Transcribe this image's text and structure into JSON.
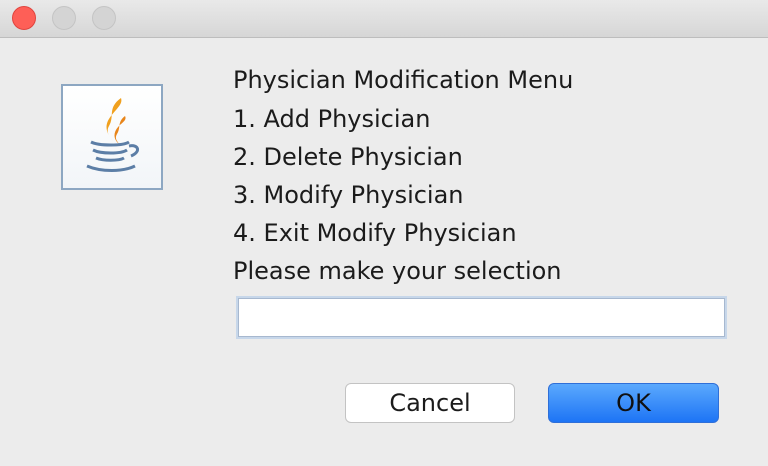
{
  "titlebar": {
    "controls": [
      "close",
      "minimize",
      "zoom"
    ]
  },
  "icon": {
    "name": "java-coffee-cup-icon"
  },
  "menu": {
    "title": "Physician Modification Menu",
    "option1": "1. Add Physician",
    "option2": "2. Delete Physician",
    "option3": "3. Modify Physician",
    "option4": "4. Exit Modify Physician",
    "prompt": "Please make your selection"
  },
  "input": {
    "value": "",
    "placeholder": ""
  },
  "buttons": {
    "cancel_label": "Cancel",
    "ok_label": "OK"
  },
  "colors": {
    "close_button": "#fe5f57",
    "ok_button": "#1d74f5",
    "dialog_background": "#ececec"
  }
}
